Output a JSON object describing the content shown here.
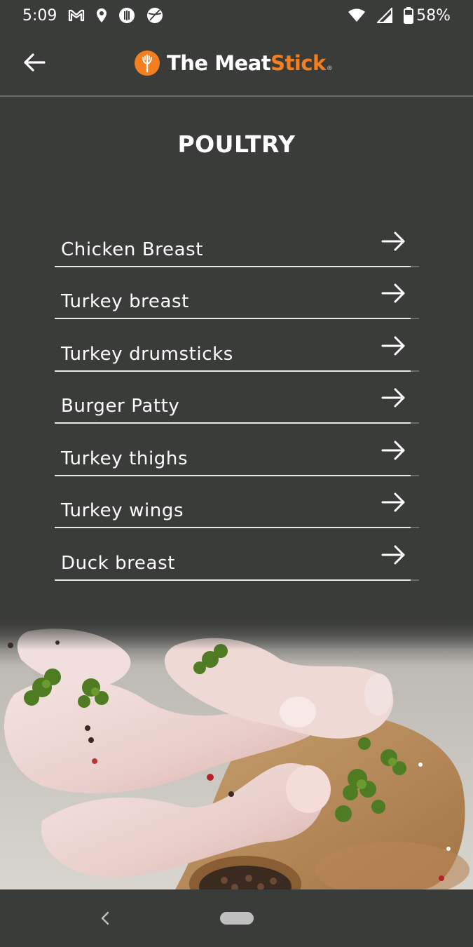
{
  "status_bar": {
    "time": "5:09",
    "battery": "58%",
    "icons": [
      "gmail-icon",
      "location-icon",
      "app-icon",
      "sports-ball-icon",
      "wifi-icon",
      "signal-icon",
      "battery-icon"
    ]
  },
  "app_bar": {
    "logo_text_primary": "The Meat",
    "logo_text_accent": "Stick",
    "logo_registered": "®",
    "accent_color": "#f47f20"
  },
  "page": {
    "title": "POULTRY"
  },
  "menu": {
    "items": [
      {
        "label": "Chicken Breast"
      },
      {
        "label": "Turkey breast"
      },
      {
        "label": "Turkey drumsticks"
      },
      {
        "label": "Burger Patty"
      },
      {
        "label": "Turkey thighs"
      },
      {
        "label": "Turkey wings"
      },
      {
        "label": "Duck breast"
      }
    ]
  },
  "image": {
    "description_icon": "raw-chicken-drumsticks-photo"
  },
  "nav_bar": {
    "icons": [
      "nav-back-icon",
      "home-pill-icon"
    ]
  }
}
